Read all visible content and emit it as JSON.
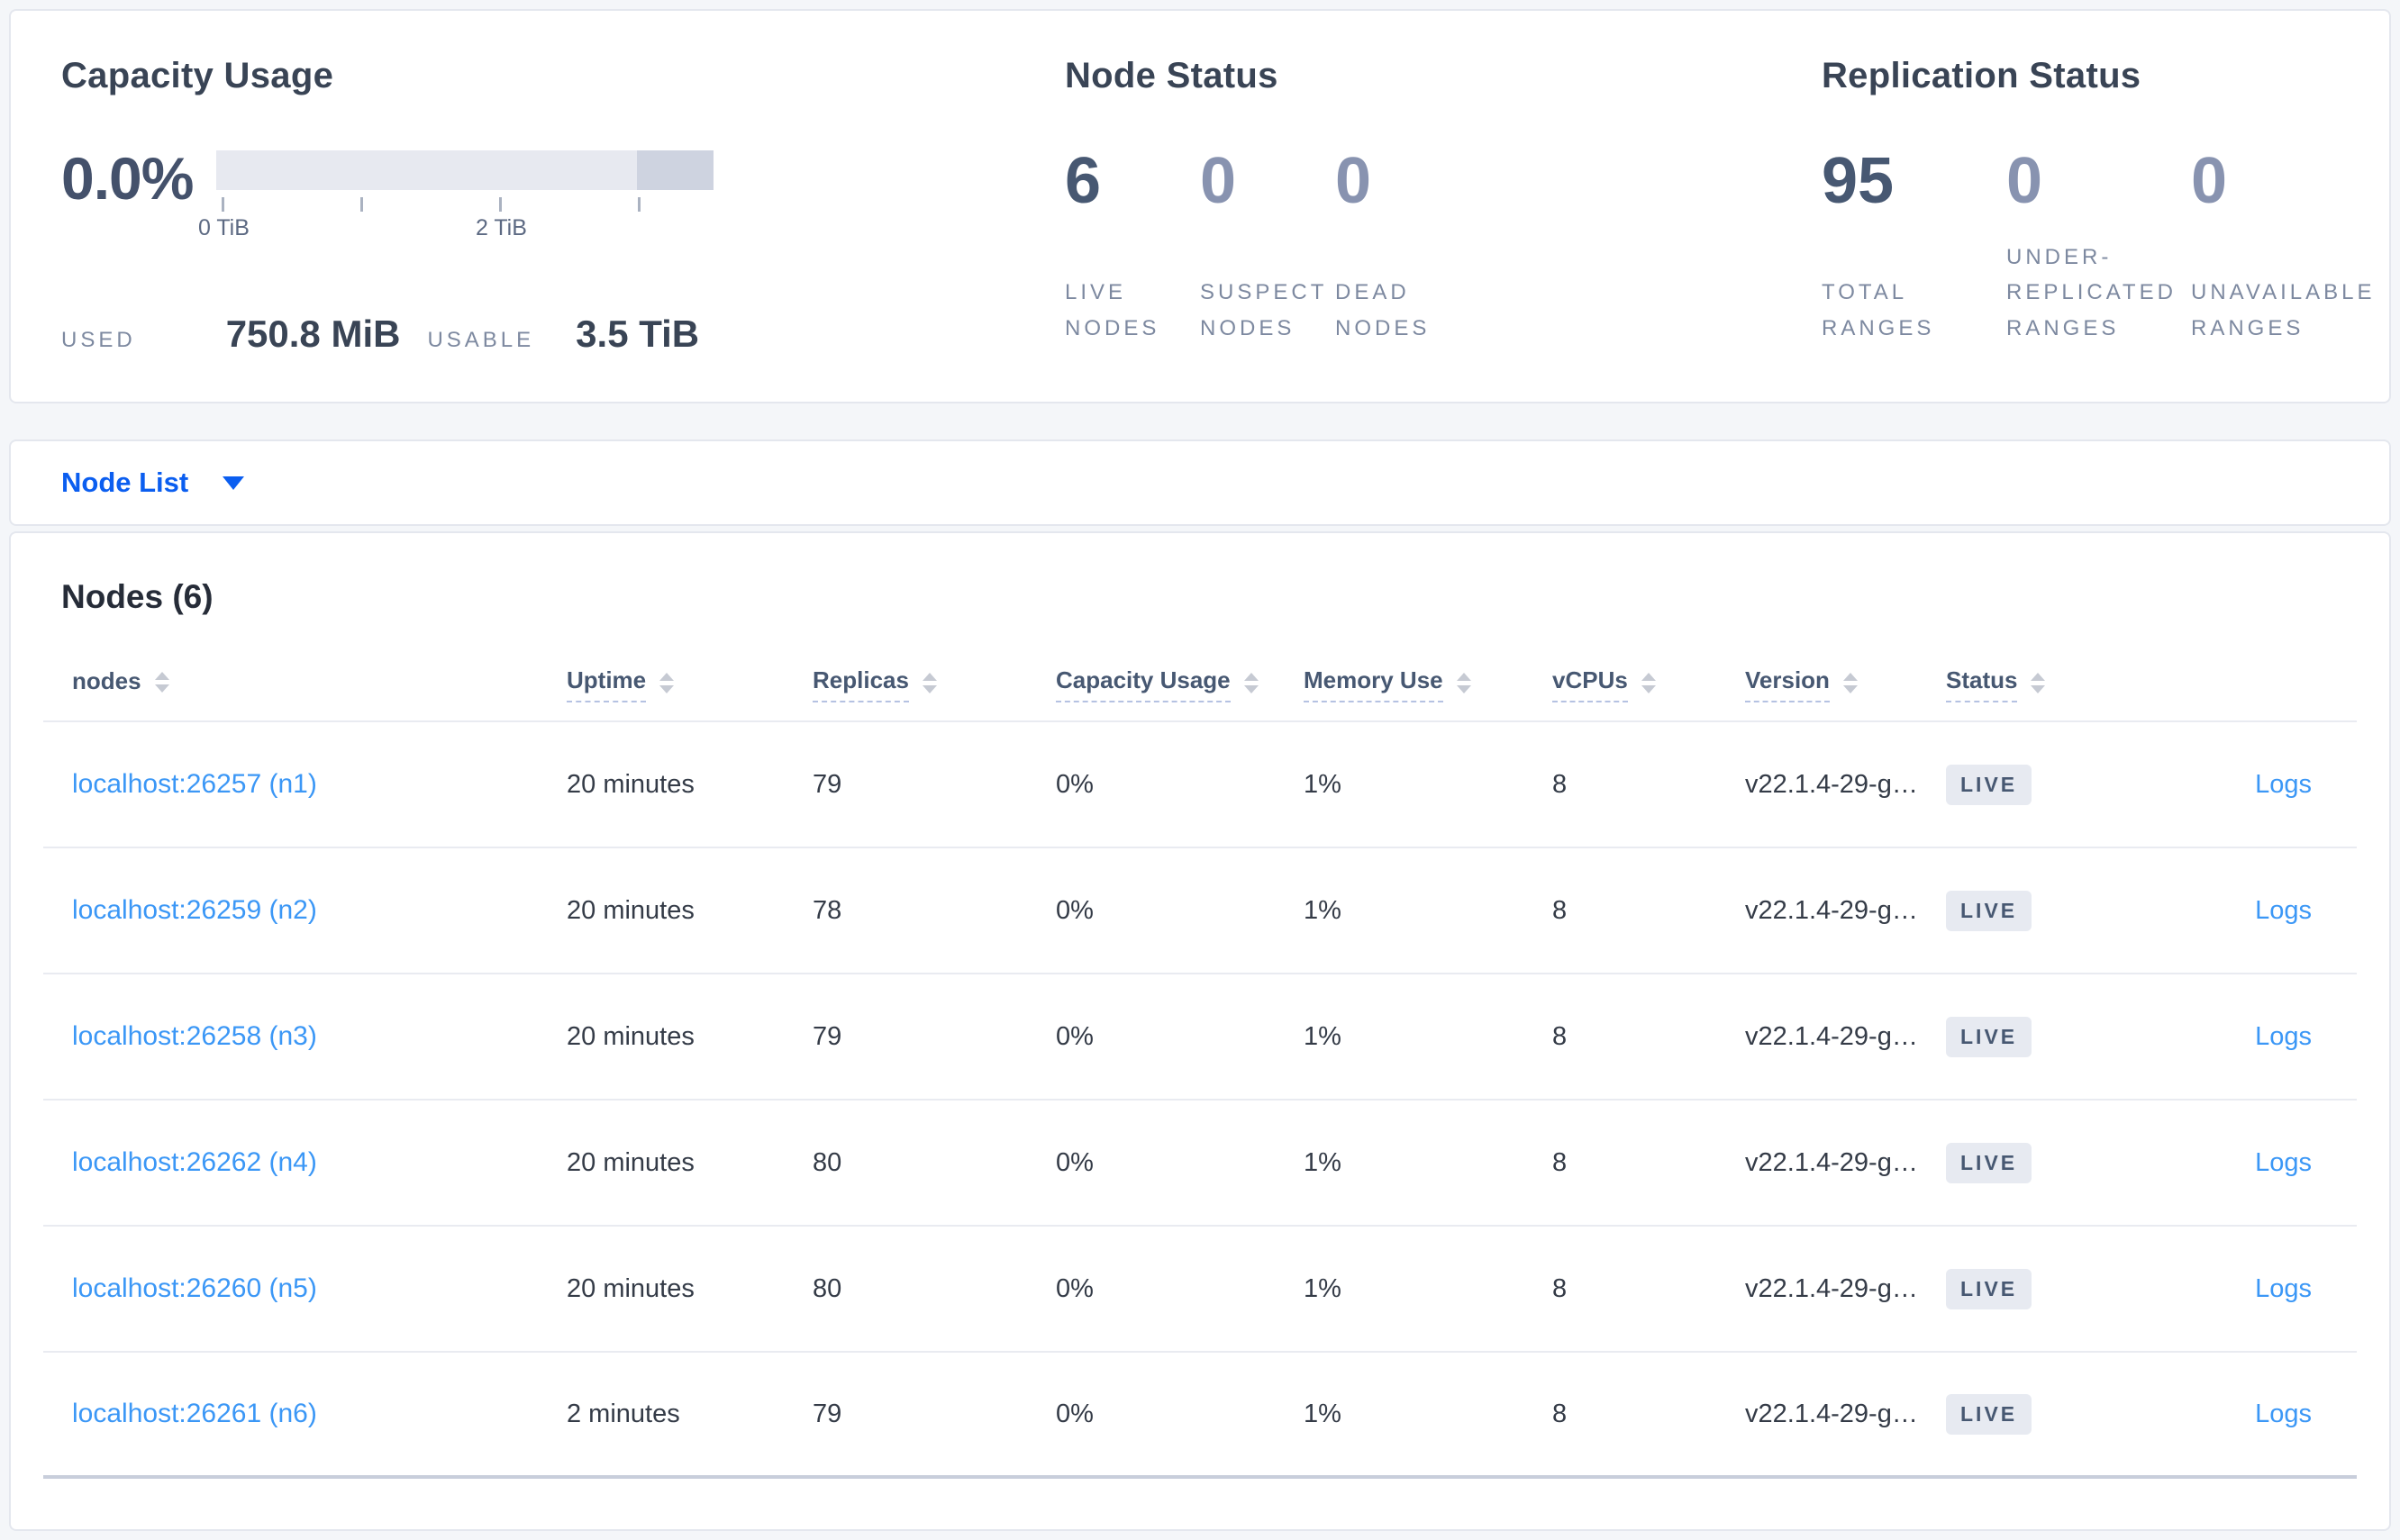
{
  "summary": {
    "capacity": {
      "title": "Capacity Usage",
      "percent": "0.0%",
      "used_label": "USED",
      "used_value": "750.8 MiB",
      "usable_label": "USABLE",
      "usable_value": "3.5 TiB",
      "meter": {
        "tick_labels": [
          "0 TiB",
          "2 TiB"
        ],
        "tick_values_tib": [
          0,
          1,
          2,
          3
        ],
        "max_tib": 3.5,
        "bar_color": "#e7e9f0",
        "bar_tail_color": "#ced3e0"
      }
    },
    "node_status": {
      "title": "Node Status",
      "stats": [
        {
          "value": "6",
          "label": "LIVE NODES"
        },
        {
          "value": "0",
          "label": "SUSPECT NODES"
        },
        {
          "value": "0",
          "label": "DEAD NODES"
        }
      ]
    },
    "replication_status": {
      "title": "Replication Status",
      "stats": [
        {
          "value": "95",
          "label": "TOTAL RANGES"
        },
        {
          "value": "0",
          "label": "UNDER-REPLICATED RANGES"
        },
        {
          "value": "0",
          "label": "UNAVAILABLE RANGES"
        }
      ]
    }
  },
  "view_selector": {
    "label": "Node List"
  },
  "nodes_table": {
    "title": "Nodes (6)",
    "columns": [
      "nodes",
      "Uptime",
      "Replicas",
      "Capacity Usage",
      "Memory Use",
      "vCPUs",
      "Version",
      "Status"
    ],
    "logs_label": "Logs",
    "rows": [
      {
        "node": "localhost:26257 (n1)",
        "uptime": "20 minutes",
        "replicas": "79",
        "capacity_usage": "0%",
        "memory_use": "1%",
        "vcpus": "8",
        "version": "v22.1.4-29-g…",
        "status": "LIVE"
      },
      {
        "node": "localhost:26259 (n2)",
        "uptime": "20 minutes",
        "replicas": "78",
        "capacity_usage": "0%",
        "memory_use": "1%",
        "vcpus": "8",
        "version": "v22.1.4-29-g…",
        "status": "LIVE"
      },
      {
        "node": "localhost:26258 (n3)",
        "uptime": "20 minutes",
        "replicas": "79",
        "capacity_usage": "0%",
        "memory_use": "1%",
        "vcpus": "8",
        "version": "v22.1.4-29-g…",
        "status": "LIVE"
      },
      {
        "node": "localhost:26262 (n4)",
        "uptime": "20 minutes",
        "replicas": "80",
        "capacity_usage": "0%",
        "memory_use": "1%",
        "vcpus": "8",
        "version": "v22.1.4-29-g…",
        "status": "LIVE"
      },
      {
        "node": "localhost:26260 (n5)",
        "uptime": "20 minutes",
        "replicas": "80",
        "capacity_usage": "0%",
        "memory_use": "1%",
        "vcpus": "8",
        "version": "v22.1.4-29-g…",
        "status": "LIVE"
      },
      {
        "node": "localhost:26261 (n6)",
        "uptime": "2 minutes",
        "replicas": "79",
        "capacity_usage": "0%",
        "memory_use": "1%",
        "vcpus": "8",
        "version": "v22.1.4-29-g…",
        "status": "LIVE"
      }
    ]
  },
  "colors": {
    "accent_blue": "#0b5ef0",
    "link_blue": "#3b97f6",
    "slate": "#475872",
    "page_background": "#f4f6f9"
  }
}
